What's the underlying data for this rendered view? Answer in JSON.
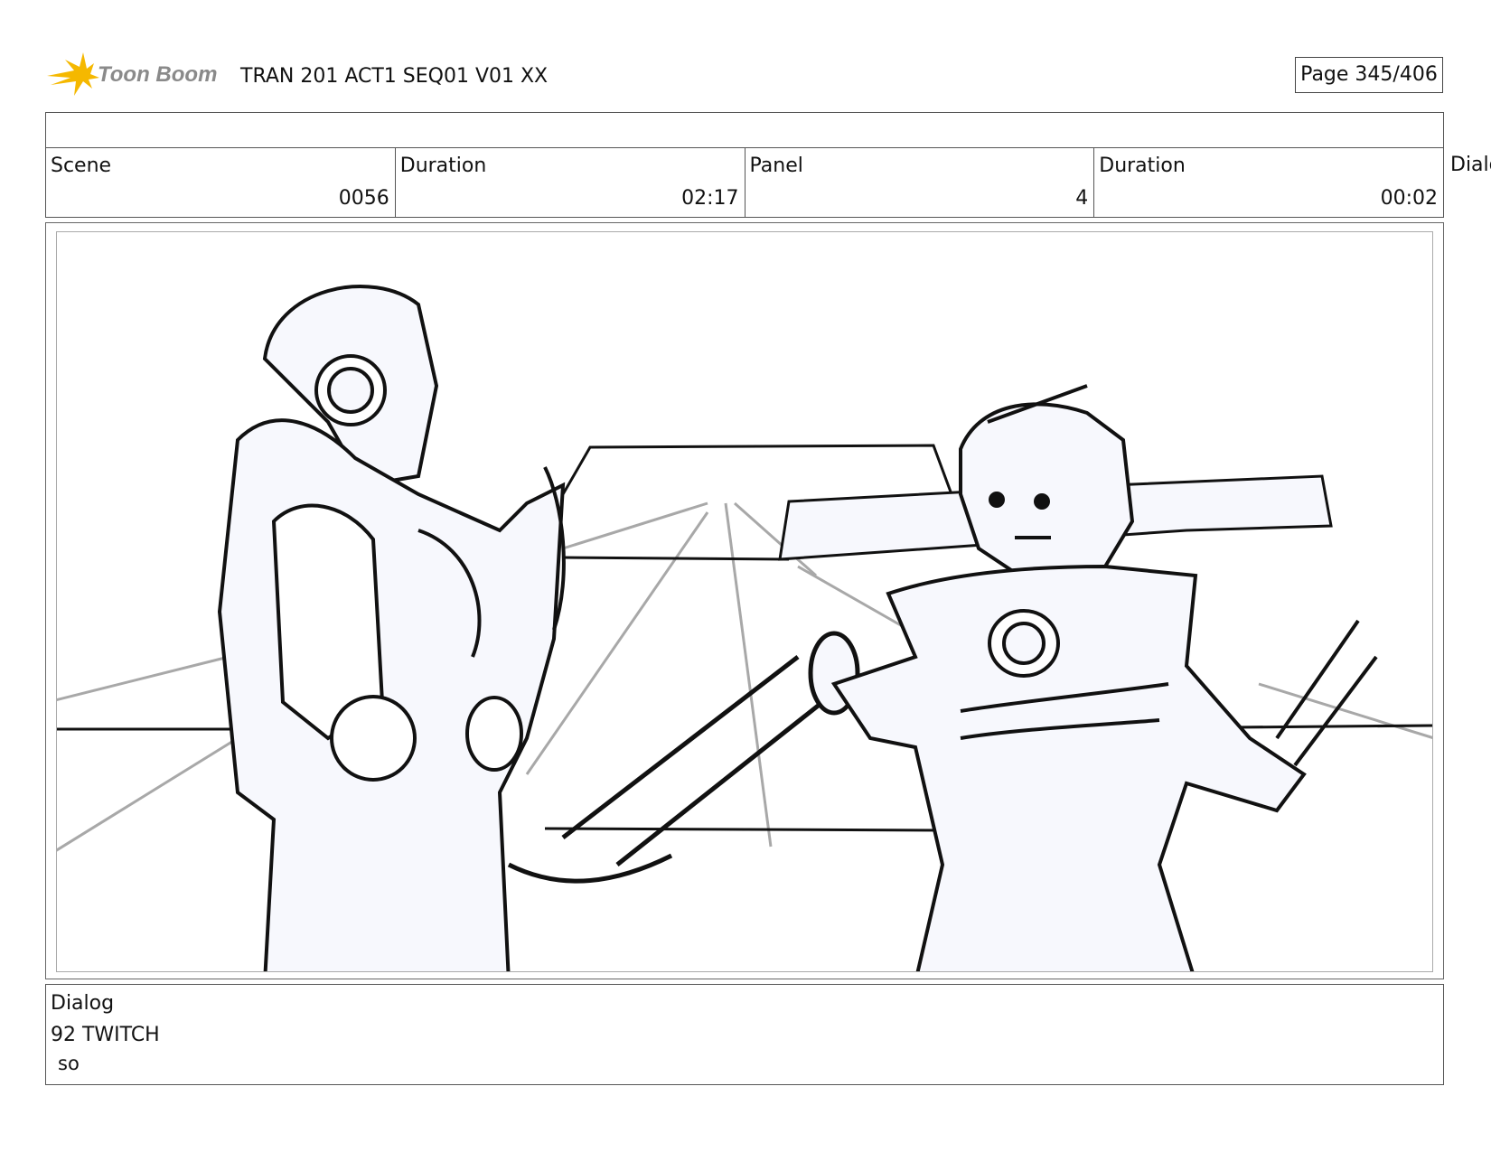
{
  "header": {
    "logo_text": "Toon Boom",
    "doc_title": "TRAN 201 ACT1 SEQ01 V01 XX",
    "page_label": "Page 345/406"
  },
  "info": {
    "scene_label": "Scene",
    "scene_value": "0056",
    "scene_duration_label": "Duration",
    "scene_duration_value": "02:17",
    "panel_label": "Panel",
    "panel_value": "4",
    "panel_duration_label": "Duration",
    "panel_duration_value": "00:02",
    "dialog_clipped_label": "Dialo"
  },
  "panel": {
    "icon": "storyboard-sketch-image"
  },
  "dialog": {
    "label": "Dialog",
    "character": "92 TWITCH",
    "line": "so"
  },
  "colors": {
    "logo_star": "#f5b800",
    "logo_text": "#8a8a8a",
    "figure_fill": "#f7f8fd",
    "sketch_line": "#111111",
    "guide_line": "#a8a8a8"
  }
}
